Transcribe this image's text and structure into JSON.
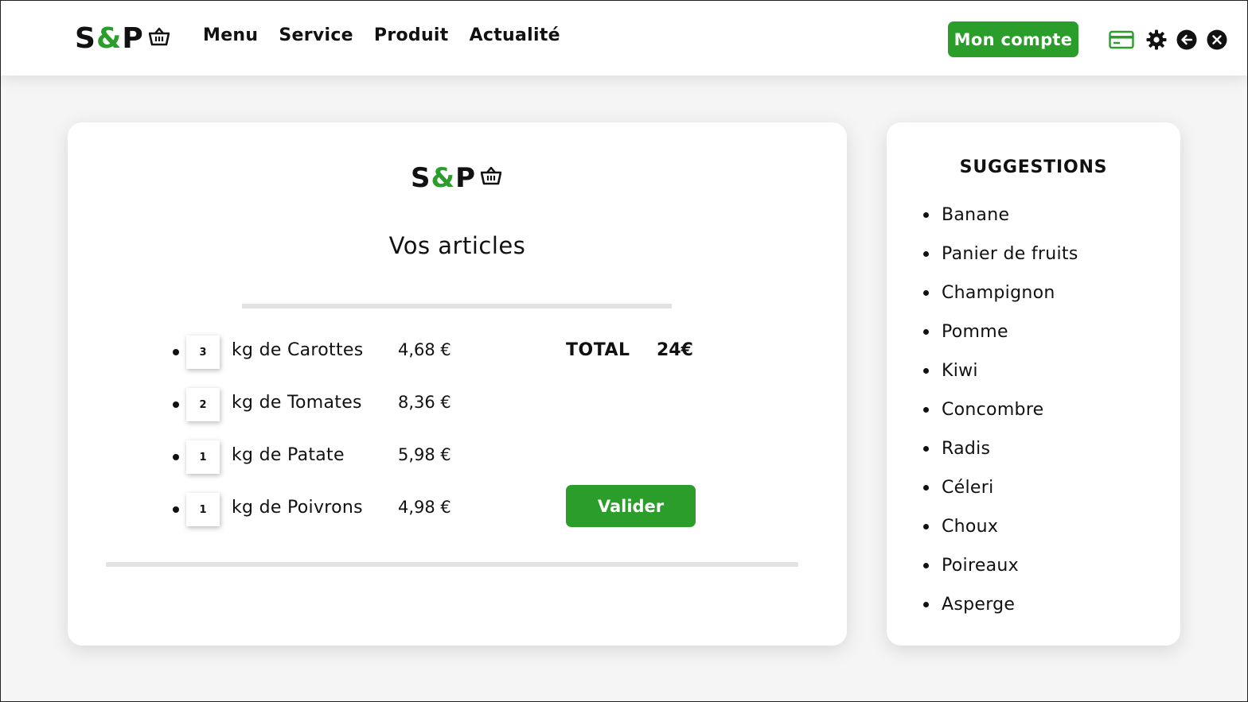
{
  "brand": {
    "s": "S",
    "amp": "&",
    "p": "P"
  },
  "colors": {
    "accent": "#2a9d2a",
    "text": "#111111",
    "background": "#f5f5f5",
    "panel": "#ffffff"
  },
  "nav": {
    "items": [
      "Menu",
      "Service",
      "Produit",
      "Actualité"
    ]
  },
  "header": {
    "account_label": "Mon compte",
    "icons": [
      "credit-card-icon",
      "gear-icon",
      "arrow-left-icon",
      "close-icon"
    ]
  },
  "cart": {
    "title": "Vos articles",
    "items": [
      {
        "qty": "3",
        "name": "kg de Carottes",
        "price": "4,68 €"
      },
      {
        "qty": "2",
        "name": "kg de Tomates",
        "price": "8,36 €"
      },
      {
        "qty": "1",
        "name": "kg de Patate",
        "price": "5,98 €"
      },
      {
        "qty": "1",
        "name": "kg de Poivrons",
        "price": "4,98 €"
      }
    ],
    "total_label": "TOTAL",
    "total_value": "24€",
    "validate_label": "Valider"
  },
  "suggestions": {
    "title": "SUGGESTIONS",
    "items": [
      "Banane",
      "Panier de fruits",
      "Champignon",
      "Pomme",
      "Kiwi",
      "Concombre",
      "Radis",
      "Céleri",
      "Choux",
      "Poireaux",
      "Asperge"
    ]
  }
}
